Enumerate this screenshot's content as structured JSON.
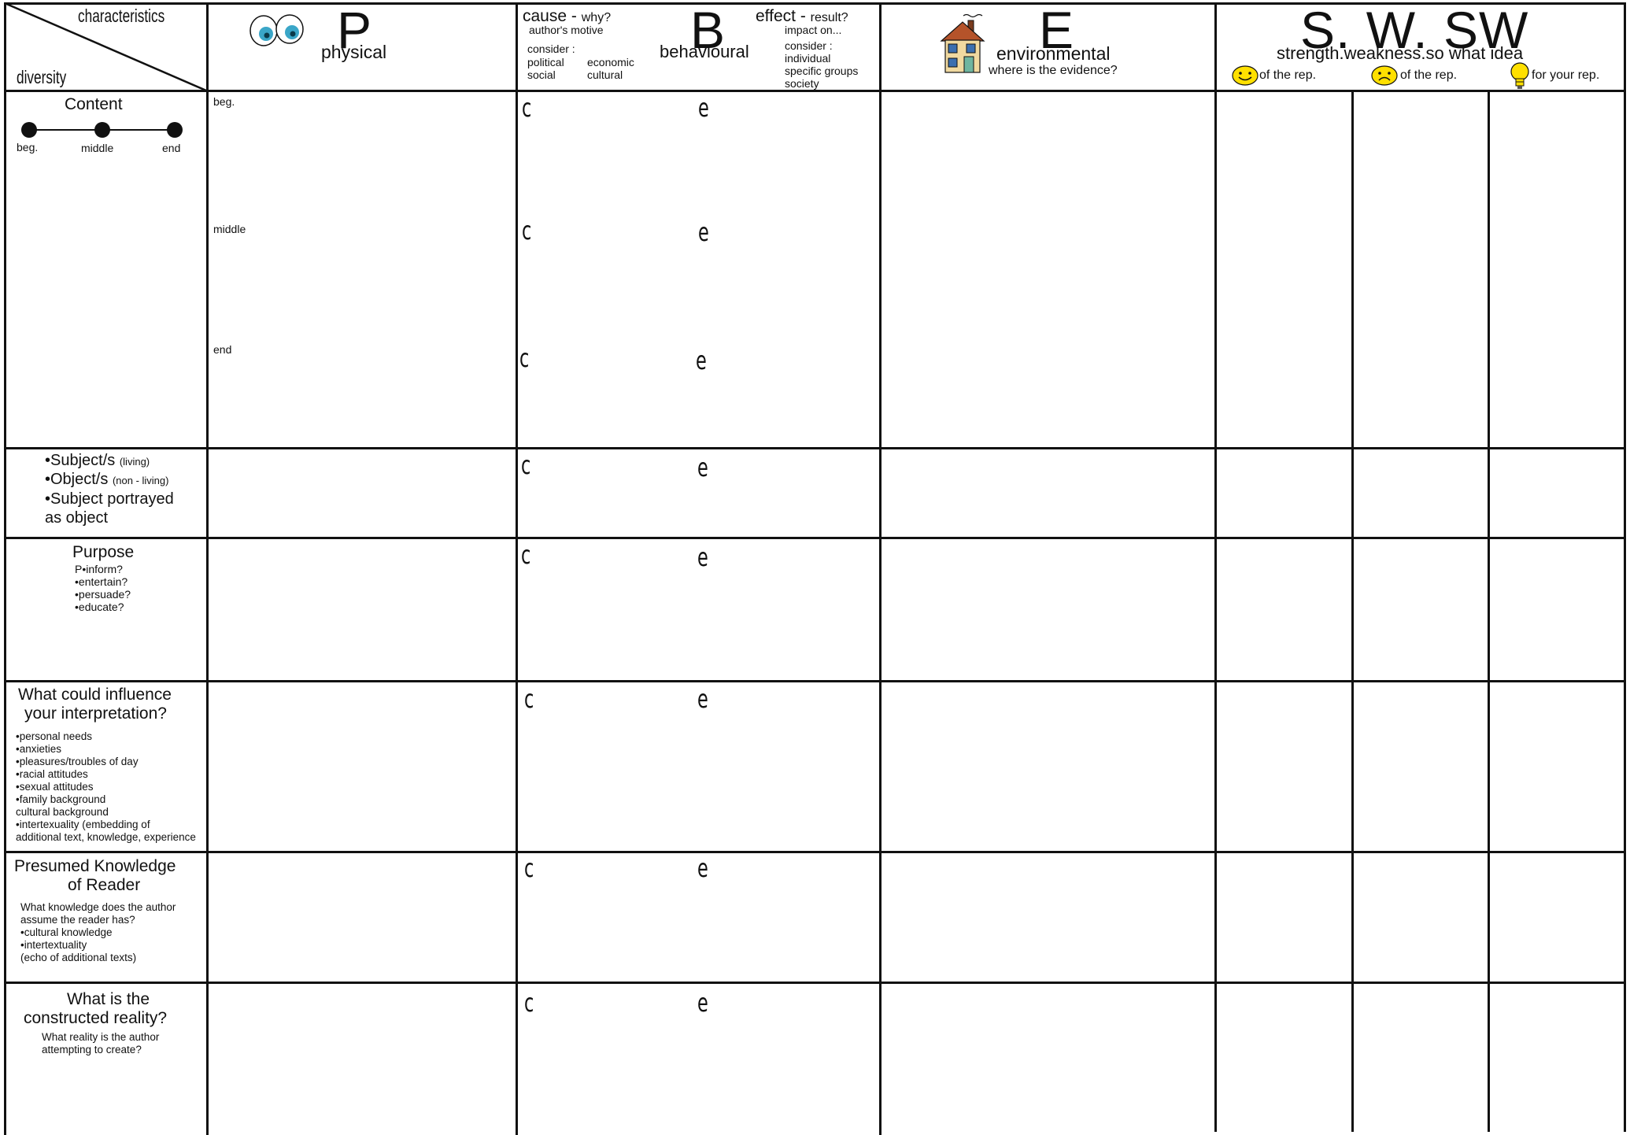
{
  "header": {
    "corner": {
      "top": "characteristics",
      "bottom": "diversity"
    },
    "p": {
      "letter": "P",
      "label": "physical"
    },
    "b": {
      "letter": "B",
      "label": "behavioural",
      "cause_title": "cause",
      "cause_dash": "-",
      "cause_q": "why?",
      "cause_sub": "author's motive",
      "consider_left": "consider :",
      "cons_l1a": "political",
      "cons_l1b": "economic",
      "cons_l2a": "social",
      "cons_l2b": "cultural",
      "effect_title": "effect",
      "effect_dash": "-",
      "effect_q": "result?",
      "effect_sub": "impact on...",
      "consider_right": "consider :",
      "cons_r1": "individual",
      "cons_r2": "specific groups",
      "cons_r3": "society"
    },
    "e": {
      "letter": "E",
      "label": "environmental",
      "sub": "where is the evidence?"
    },
    "s": {
      "letters": "S. W. SW",
      "label": "strength.weakness.so what idea",
      "col1": "of the rep.",
      "col2": "of the rep.",
      "col3": "for your rep."
    }
  },
  "rows": {
    "content": {
      "title": "Content",
      "beg": "beg.",
      "middle": "middle",
      "end": "end"
    },
    "p_content": {
      "beg": "beg.",
      "middle": "middle",
      "end": "end"
    },
    "subject": {
      "l1": "•Subject/s",
      "l1s": "(living)",
      "l2": "•Object/s",
      "l2s": "(non - living)",
      "l3": "•Subject portrayed",
      "l4": "as object"
    },
    "purpose": {
      "title": "Purpose",
      "items": "P•inform?\n•entertain?\n•persuade?\n•educate?"
    },
    "influence": {
      "title1": "What could influence",
      "title2": "your interpretation?",
      "items": "•personal needs\n•anxieties\n•pleasures/troubles of day\n•racial attitudes\n•sexual attitudes\n•family background\ncultural background\n•intertexuality (embedding of\nadditional text, knowledge, experience"
    },
    "knowledge": {
      "title1": "Presumed Knowledge",
      "title2": "of Reader",
      "items": "What knowledge does the author\nassume the reader has?\n•cultural knowledge\n•intertextuality\n(echo of additional texts)"
    },
    "reality": {
      "title1": "What is the",
      "title2": "constructed reality?",
      "items": "What reality is the author\nattempting to create?"
    }
  },
  "ce": {
    "c": "c",
    "e": "e"
  },
  "icons": {
    "eyes": "eyes-icon",
    "house": "house-icon",
    "smile": "smiley-icon",
    "frown": "frown-icon",
    "bulb": "lightbulb-icon"
  },
  "colors": {
    "line": "#111111",
    "eye_iris": "#3aa6c8",
    "face": "#ffe000",
    "house_roof": "#b5532a",
    "house_wall": "#f0d9a0"
  }
}
